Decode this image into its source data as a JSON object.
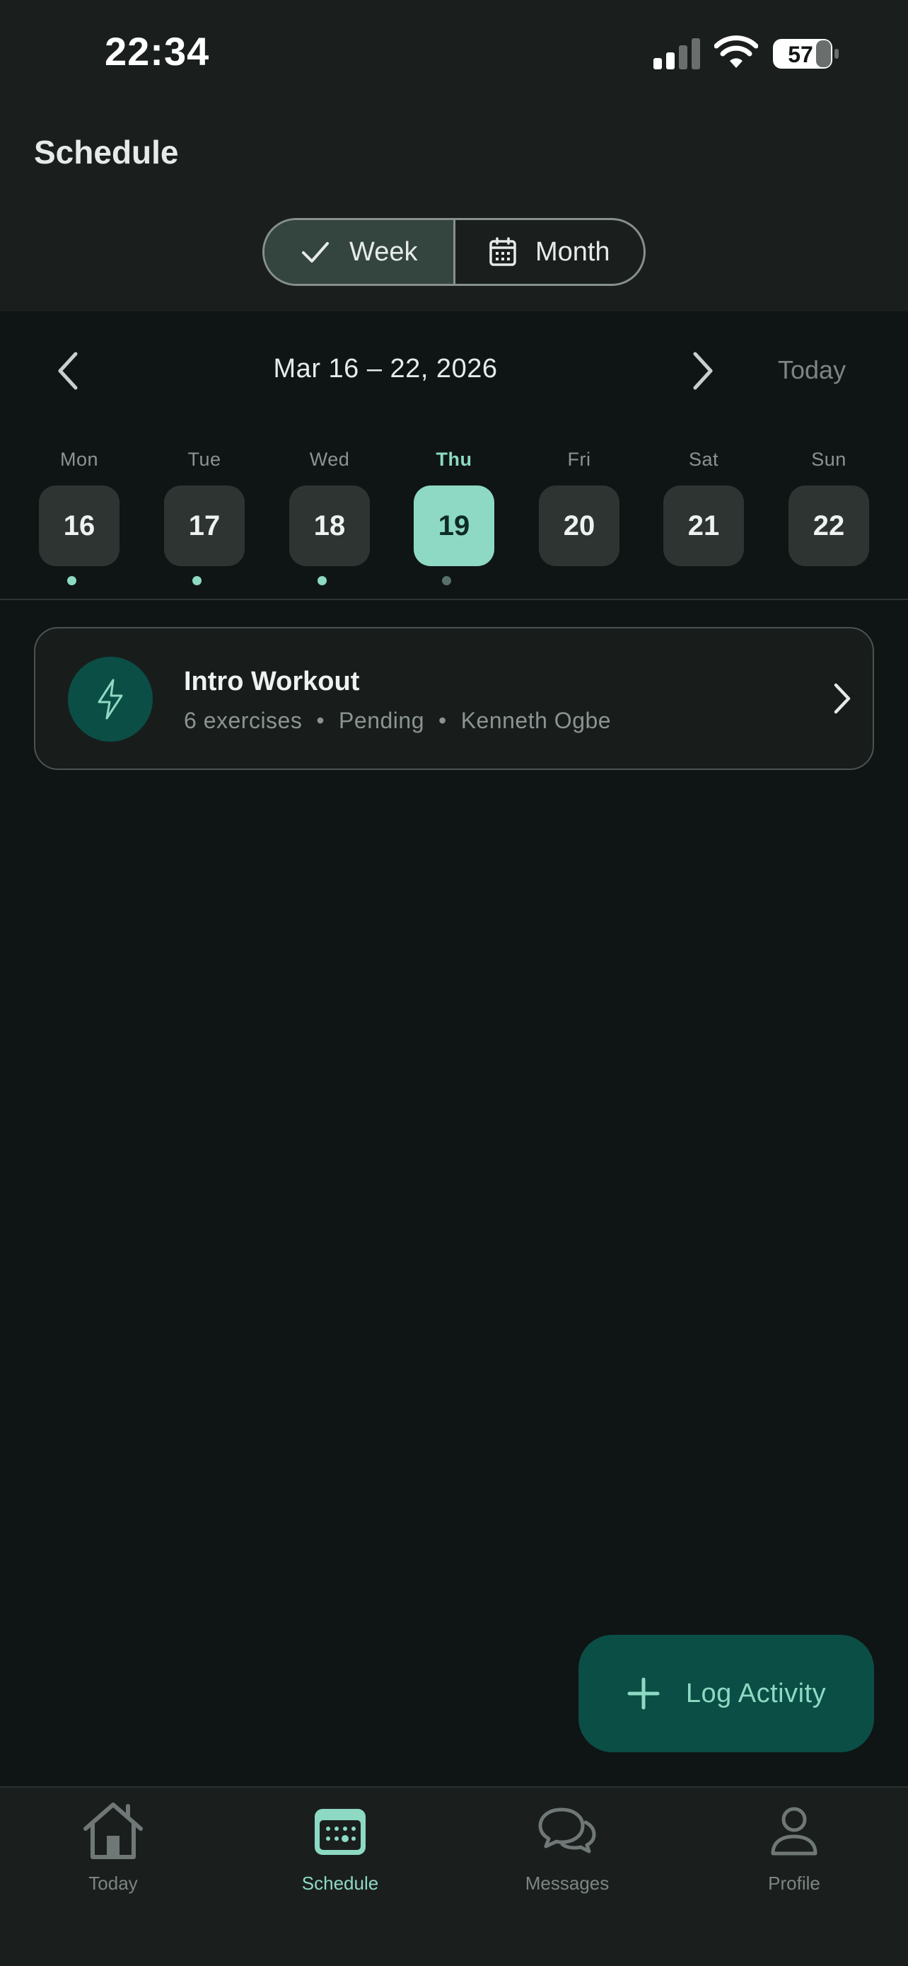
{
  "status_bar": {
    "time": "22:34",
    "battery": "57"
  },
  "header": {
    "title": "Schedule"
  },
  "view_toggle": {
    "week_label": "Week",
    "month_label": "Month",
    "selected": "Week"
  },
  "week_nav": {
    "range": "Mar 16 – 22, 2026",
    "today_label": "Today"
  },
  "days": [
    {
      "name": "Mon",
      "number": "16",
      "has_event": true,
      "selected": false
    },
    {
      "name": "Tue",
      "number": "17",
      "has_event": true,
      "selected": false
    },
    {
      "name": "Wed",
      "number": "18",
      "has_event": true,
      "selected": false
    },
    {
      "name": "Thu",
      "number": "19",
      "has_event": true,
      "selected": true
    },
    {
      "name": "Fri",
      "number": "20",
      "has_event": false,
      "selected": false
    },
    {
      "name": "Sat",
      "number": "21",
      "has_event": false,
      "selected": false
    },
    {
      "name": "Sun",
      "number": "22",
      "has_event": false,
      "selected": false
    }
  ],
  "workout": {
    "title": "Intro Workout",
    "exercises": "6 exercises",
    "status": "Pending",
    "coach": "Kenneth Ogbe",
    "separator": "•",
    "icon": "lightning-icon"
  },
  "fab": {
    "label": "Log Activity",
    "icon": "plus-icon"
  },
  "tabs": [
    {
      "label": "Today",
      "icon": "home-icon",
      "active": false
    },
    {
      "label": "Schedule",
      "icon": "calendar-icon",
      "active": true
    },
    {
      "label": "Messages",
      "icon": "chat-bubbles-icon",
      "active": false
    },
    {
      "label": "Profile",
      "icon": "person-icon",
      "active": false
    }
  ],
  "colors": {
    "background": "#0f1514",
    "surface": "#1a1f1e",
    "accent": "#8ed9c4",
    "accent_dark": "#0b4e45",
    "muted_text": "#7c8583"
  }
}
